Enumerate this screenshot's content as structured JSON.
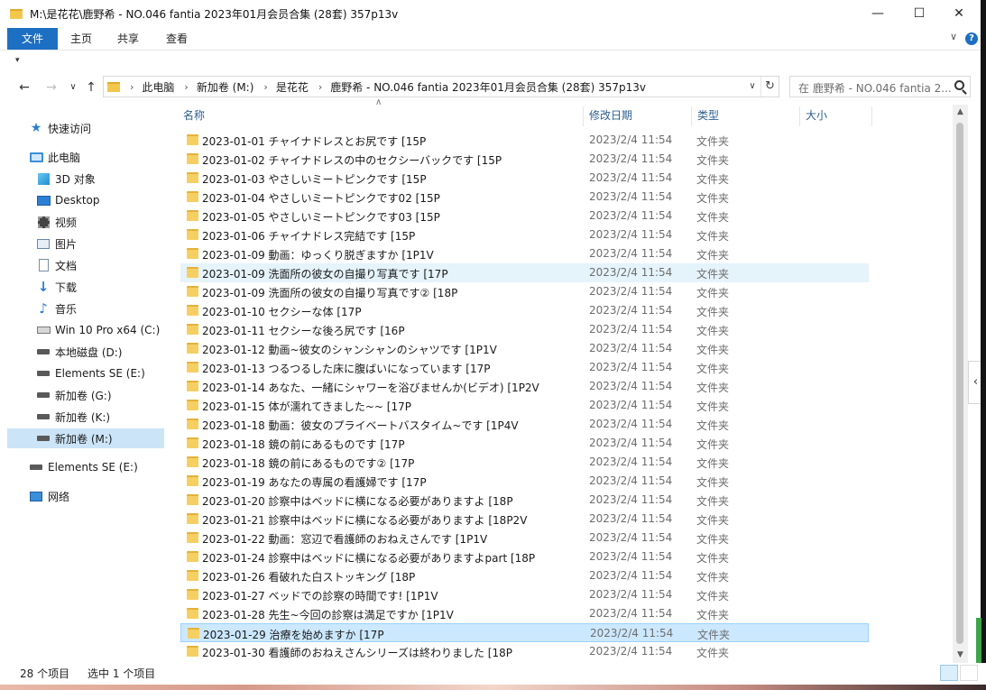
{
  "window": {
    "title": "M:\\是花花\\鹿野希 - NO.046 fantia 2023年01月会员合集 (28套) 357p13v"
  },
  "ribbon": {
    "tabs": [
      {
        "label": "文件",
        "active": true
      },
      {
        "label": "主页",
        "active": false
      },
      {
        "label": "共享",
        "active": false
      },
      {
        "label": "查看",
        "active": false
      }
    ]
  },
  "address": {
    "crumbs": [
      "此电脑",
      "新加卷 (M:)",
      "是花花",
      "鹿野希 - NO.046 fantia 2023年01月会员合集 (28套) 357p13v"
    ]
  },
  "search": {
    "placeholder": "在 鹿野希 - NO.046 fantia 2..."
  },
  "sidebar": {
    "items": [
      {
        "label": "快速访问",
        "icon": "star-icon"
      },
      {
        "label": "此电脑",
        "icon": "computer-icon"
      },
      {
        "label": "3D 对象",
        "icon": "cube-icon"
      },
      {
        "label": "Desktop",
        "icon": "desktop-icon"
      },
      {
        "label": "视频",
        "icon": "video-icon"
      },
      {
        "label": "图片",
        "icon": "picture-icon"
      },
      {
        "label": "文档",
        "icon": "document-icon"
      },
      {
        "label": "下载",
        "icon": "download-icon"
      },
      {
        "label": "音乐",
        "icon": "music-icon"
      },
      {
        "label": "Win 10 Pro x64 (C:)",
        "icon": "system-drive-icon"
      },
      {
        "label": "本地磁盘 (D:)",
        "icon": "drive-icon"
      },
      {
        "label": "Elements SE (E:)",
        "icon": "drive-icon"
      },
      {
        "label": "新加卷 (G:)",
        "icon": "drive-icon"
      },
      {
        "label": "新加卷 (K:)",
        "icon": "drive-icon"
      },
      {
        "label": "新加卷 (M:)",
        "icon": "drive-icon",
        "selected": true
      },
      {
        "label": "Elements SE (E:)",
        "icon": "drive-icon"
      },
      {
        "label": "网络",
        "icon": "network-icon"
      }
    ]
  },
  "columns": {
    "name": "名称",
    "date": "修改日期",
    "type": "类型",
    "size": "大小"
  },
  "files": [
    {
      "name": "2023-01-01 チャイナドレスとお尻です [15P",
      "date": "2023/2/4 11:54",
      "type": "文件夹"
    },
    {
      "name": "2023-01-02 チャイナドレスの中のセクシーバックです [15P",
      "date": "2023/2/4 11:54",
      "type": "文件夹"
    },
    {
      "name": "2023-01-03 やさしいミートピンクです [15P",
      "date": "2023/2/4 11:54",
      "type": "文件夹"
    },
    {
      "name": "2023-01-04 やさしいミートピンクです02 [15P",
      "date": "2023/2/4 11:54",
      "type": "文件夹"
    },
    {
      "name": "2023-01-05 やさしいミートピンクです03 [15P",
      "date": "2023/2/4 11:54",
      "type": "文件夹"
    },
    {
      "name": "2023-01-06 チャイナドレス完結です [15P",
      "date": "2023/2/4 11:54",
      "type": "文件夹"
    },
    {
      "name": "2023-01-09 動画：ゆっくり脱ぎますか [1P1V",
      "date": "2023/2/4 11:54",
      "type": "文件夹"
    },
    {
      "name": "2023-01-09 洗面所の彼女の自撮り写真です [17P",
      "date": "2023/2/4 11:54",
      "type": "文件夹",
      "state": "hover"
    },
    {
      "name": "2023-01-09 洗面所の彼女の自撮り写真です② [18P",
      "date": "2023/2/4 11:54",
      "type": "文件夹"
    },
    {
      "name": "2023-01-10 セクシーな体 [17P",
      "date": "2023/2/4 11:54",
      "type": "文件夹"
    },
    {
      "name": "2023-01-11 セクシーな後ろ尻です [16P",
      "date": "2023/2/4 11:54",
      "type": "文件夹"
    },
    {
      "name": "2023-01-12 動画~彼女のシャンシャンのシャツです [1P1V",
      "date": "2023/2/4 11:54",
      "type": "文件夹"
    },
    {
      "name": "2023-01-13 つるつるした床に腹ばいになっています [17P",
      "date": "2023/2/4 11:54",
      "type": "文件夹"
    },
    {
      "name": "2023-01-14 あなた、一緒にシャワーを浴びませんか(ビデオ) [1P2V",
      "date": "2023/2/4 11:54",
      "type": "文件夹"
    },
    {
      "name": "2023-01-15 体が濡れてきました~~ [17P",
      "date": "2023/2/4 11:54",
      "type": "文件夹"
    },
    {
      "name": "2023-01-18 動画：彼女のプライベートバスタイム~です [1P4V",
      "date": "2023/2/4 11:54",
      "type": "文件夹"
    },
    {
      "name": "2023-01-18 鏡の前にあるものです [17P",
      "date": "2023/2/4 11:54",
      "type": "文件夹"
    },
    {
      "name": "2023-01-18 鏡の前にあるものです② [17P",
      "date": "2023/2/4 11:54",
      "type": "文件夹"
    },
    {
      "name": "2023-01-19 あなたの専属の看護婦です [17P",
      "date": "2023/2/4 11:54",
      "type": "文件夹"
    },
    {
      "name": "2023-01-20 診察中はベッドに横になる必要がありますよ [18P",
      "date": "2023/2/4 11:54",
      "type": "文件夹"
    },
    {
      "name": "2023-01-21 診察中はベッドに横になる必要がありますよ [18P2V",
      "date": "2023/2/4 11:54",
      "type": "文件夹"
    },
    {
      "name": "2023-01-22 動画：窓辺で看護師のおねえさんです [1P1V",
      "date": "2023/2/4 11:54",
      "type": "文件夹"
    },
    {
      "name": "2023-01-24 診察中はベッドに横になる必要がありますよpart [18P",
      "date": "2023/2/4 11:54",
      "type": "文件夹"
    },
    {
      "name": "2023-01-26 看破れた白ストッキング [18P",
      "date": "2023/2/4 11:54",
      "type": "文件夹"
    },
    {
      "name": "2023-01-27 ベッドでの診察の時間です! [1P1V",
      "date": "2023/2/4 11:54",
      "type": "文件夹"
    },
    {
      "name": "2023-01-28 先生~今回の診察は満足ですか [1P1V",
      "date": "2023/2/4 11:54",
      "type": "文件夹"
    },
    {
      "name": "2023-01-29 治療を始めますか [17P",
      "date": "2023/2/4 11:54",
      "type": "文件夹",
      "state": "selected"
    },
    {
      "name": "2023-01-30 看護師のおねえさんシリーズは終わりました [18P",
      "date": "2023/2/4 11:54",
      "type": "文件夹"
    }
  ],
  "status": {
    "count": "28 个项目",
    "selection": "选中 1 个项目"
  }
}
